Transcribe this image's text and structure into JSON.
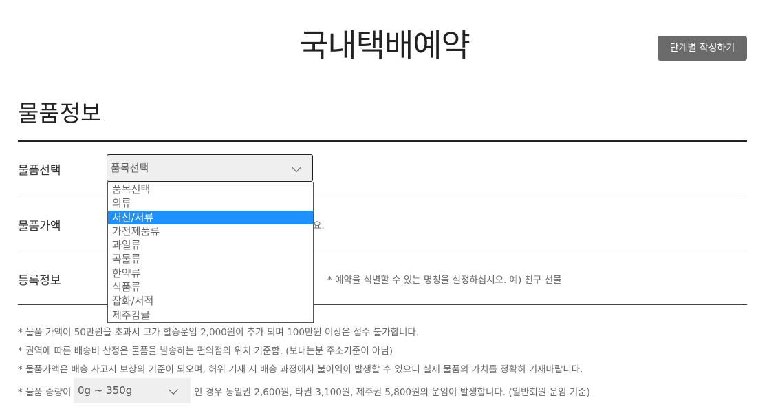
{
  "header": {
    "title": "국내택배예약",
    "step_button": "단계별 작성하기"
  },
  "section": {
    "title": "물품정보"
  },
  "rows": {
    "item_select_label": "물품선택",
    "item_value_label": "물품가액",
    "register_label": "등록정보"
  },
  "item_select": {
    "selected": "품목선택",
    "options": [
      "품목선택",
      "의류",
      "서신/서류",
      "가전제품류",
      "과일류",
      "곡물류",
      "한약류",
      "식품류",
      "잡화/서적",
      "제주감귤"
    ],
    "highlighted": "서신/서류"
  },
  "item_value_hint_fragment": "요.",
  "register_hint": "* 예약을 식별할 수 있는 명칭을 설정하십시오. 예) 친구 선물",
  "notes": [
    "* 물품 가액이 50만원을 초과시 고가 할증운임 2,000원이 추가 되며 100만원 이상은 접수 불가합니다.",
    "* 권역에 따른 배송비 산정은 물품을 발송하는 편의점의 위치 기준함. (보내는분 주소기준이 아님)",
    "* 물품가액은 배송 사고시 보상의 기준이 되오며, 허위 기재 시 배송 과정에서 불이익이 발생할 수 있으니 실제 물품의 가치를 정확히 기재바랍니다."
  ],
  "weight": {
    "prefix": "* 물품 중량이",
    "selected": "0g ~ 350g",
    "suffix": "인 경우  동일권 2,600원, 타권 3,100원, 제주권 5,800원의 운임이 발생합니다. (일반회원 운임 기준)"
  }
}
